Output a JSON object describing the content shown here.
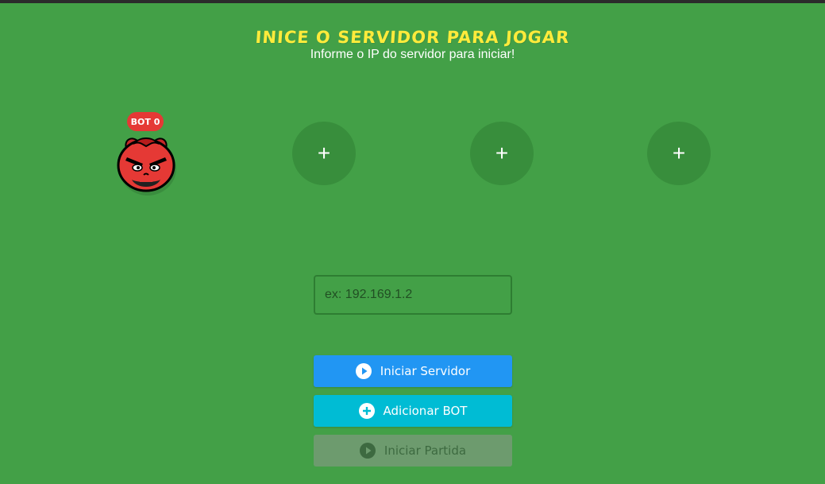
{
  "header": {
    "title": "INICE O SERVIDOR PARA JOGAR",
    "subtitle": "Informe o IP do servidor para iniciar!"
  },
  "players": [
    {
      "badge": "BOT 0",
      "avatar_icon": "red-demon-face-avatar"
    },
    {
      "label": "+"
    },
    {
      "label": "+"
    },
    {
      "label": "+"
    }
  ],
  "ip_input": {
    "placeholder": "ex: 192.169.1.2",
    "value": ""
  },
  "buttons": {
    "start_server": "Iniciar Servidor",
    "add_bot": "Adicionar BOT",
    "start_match": "Iniciar Partida"
  },
  "icons": {
    "start_server": "play-circle-icon",
    "add_bot": "plus-circle-icon",
    "start_match": "play-circle-icon"
  },
  "colors": {
    "background": "#43a047",
    "title": "#ffeb3b",
    "empty_slot": "#388e3c",
    "bot_badge": "#e53935",
    "start_server_button": "#2196f3",
    "add_bot_button": "#00bcd4",
    "start_match_button_disabled": "#6d9b6e"
  }
}
